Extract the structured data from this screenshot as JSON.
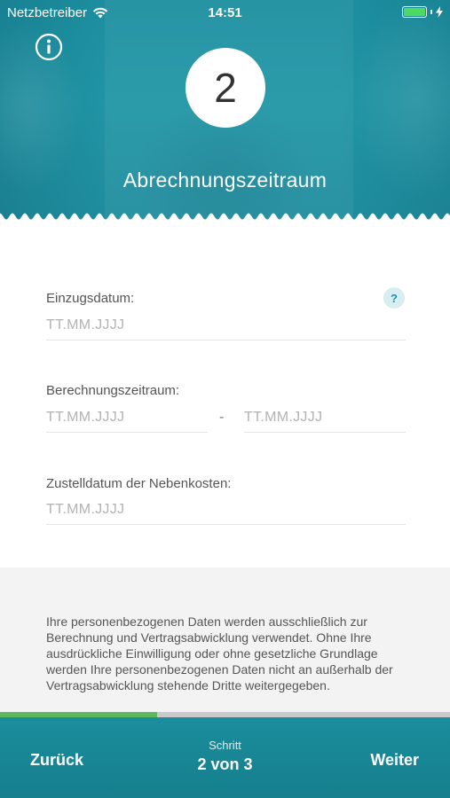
{
  "status_bar": {
    "carrier": "Netzbetreiber",
    "time": "14:51",
    "battery_level": 1.0
  },
  "header": {
    "step_number": "2",
    "title": "Abrechnungszeitraum",
    "info_icon": "info-icon"
  },
  "form": {
    "move_in": {
      "label": "Einzugsdatum:",
      "placeholder": "TT.MM.JJJJ",
      "value": "",
      "help": "?"
    },
    "billing_period": {
      "label": "Berechnungszeitraum:",
      "from_placeholder": "TT.MM.JJJJ",
      "to_placeholder": "TT.MM.JJJJ",
      "separator": "-"
    },
    "delivery_date": {
      "label": "Zustelldatum der Nebenkosten:",
      "placeholder": "TT.MM.JJJJ",
      "value": ""
    }
  },
  "privacy_text": "Ihre personenbezogenen Daten werden ausschließlich zur Berechnung und Vertragsabwicklung verwendet. Ohne Ihre ausdrückliche Einwilligung oder ohne gesetzliche Grundlage werden Ihre personenbezogenen Daten nicht an außerhalb der Vertragsabwicklung stehende Dritte weitergegeben.",
  "progress": {
    "fraction": 0.35
  },
  "footer": {
    "back_label": "Zurück",
    "step_caption": "Schritt",
    "step_value": "2 von 3",
    "next_label": "Weiter"
  },
  "colors": {
    "brand": "#1c8fa0",
    "progress": "#5cb85c",
    "help_bg": "#d8eef1"
  }
}
